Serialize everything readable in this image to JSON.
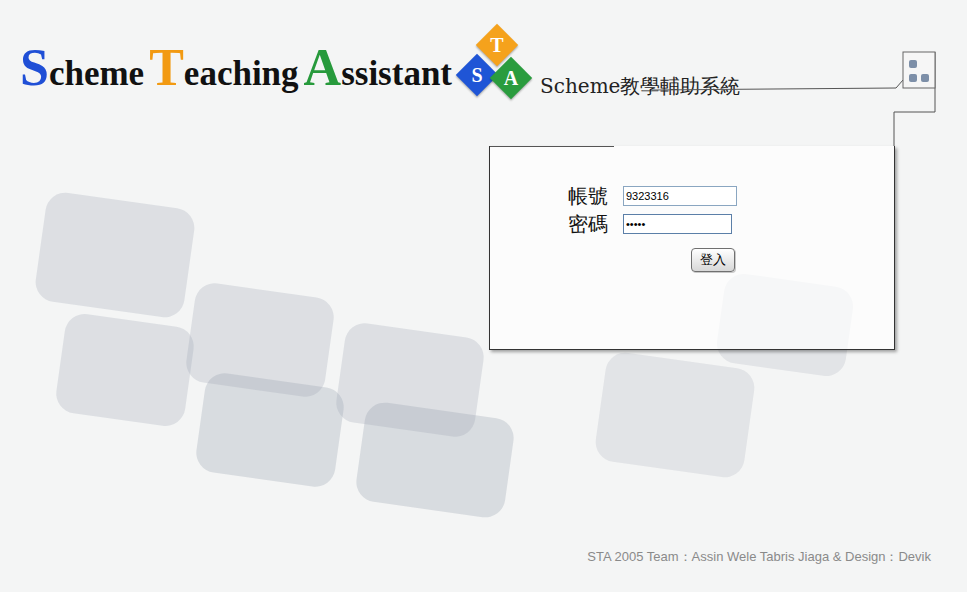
{
  "logo": {
    "words": [
      {
        "initial": "S",
        "rest": "cheme",
        "color": "#1f4fd6"
      },
      {
        "initial": "T",
        "rest": "eaching",
        "color": "#f29a12"
      },
      {
        "initial": "A",
        "rest": "ssistant",
        "color": "#279a3c"
      }
    ],
    "badge": [
      {
        "letter": "T",
        "color": "#f5a21c"
      },
      {
        "letter": "S",
        "color": "#1f55d6"
      },
      {
        "letter": "A",
        "color": "#2a9c3e"
      }
    ],
    "subtitle": "Scheme教學輔助系統"
  },
  "login": {
    "fields": [
      {
        "label": "帳號",
        "value": "9323316",
        "focused": false
      },
      {
        "label": "密碼",
        "value": "•••••",
        "focused": true
      }
    ],
    "button": "登入"
  },
  "footer": "STA 2005 Team：Assin Wele Tabris Jiaga & Design：Devik"
}
